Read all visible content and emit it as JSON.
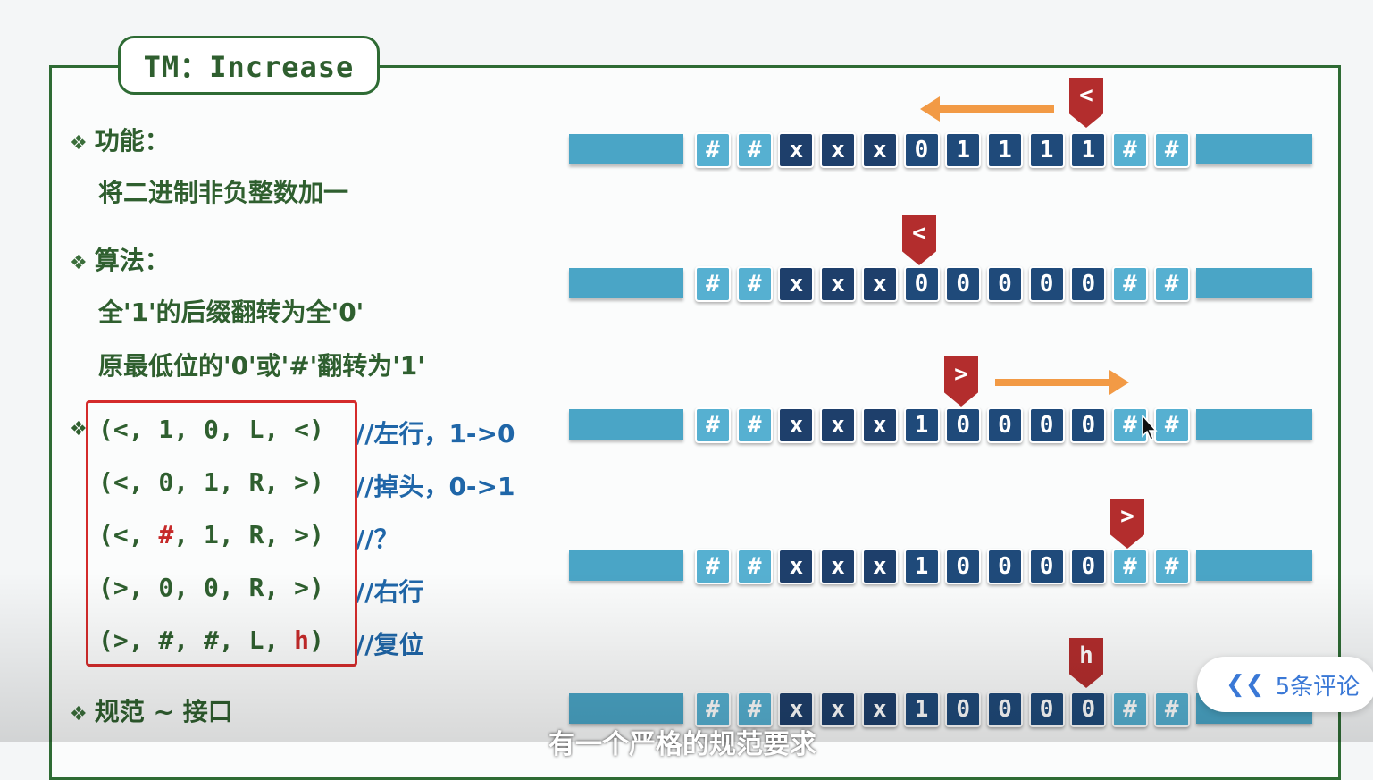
{
  "title": "TM：Increase",
  "sections": {
    "function_title": "功能：",
    "function_desc": "将二进制非负整数加一",
    "algorithm_title": "算法：",
    "algorithm_line1": "全'1'的后缀翻转为全'0'",
    "algorithm_line2": "原最低位的'0'或'#'翻转为'1'",
    "spec_title": "规范 ~ 接口"
  },
  "rules": [
    {
      "pre": "(<, 1, 0, L, <)",
      "comment": "//左行，1->0"
    },
    {
      "pre": "(<, 0, 1, R, >)",
      "comment": "//掉头，0->1"
    },
    {
      "pre_a": "(<, ",
      "pre_red": "#",
      "pre_b": ", 1, R, >)",
      "comment": "//？"
    },
    {
      "pre": "(>, 0, 0, R, >)",
      "comment": "//右行"
    },
    {
      "pre_a": "(>, #, #, L, ",
      "pre_red": "h",
      "pre_b": ")",
      "comment": "//复位"
    }
  ],
  "tapes": [
    {
      "cells": [
        "#",
        "#",
        "x",
        "x",
        "x",
        "0",
        "1",
        "1",
        "1",
        "1",
        "#",
        "#"
      ],
      "head": "<"
    },
    {
      "cells": [
        "#",
        "#",
        "x",
        "x",
        "x",
        "0",
        "0",
        "0",
        "0",
        "0",
        "#",
        "#"
      ],
      "head": "<"
    },
    {
      "cells": [
        "#",
        "#",
        "x",
        "x",
        "x",
        "1",
        "0",
        "0",
        "0",
        "0",
        "#",
        "#"
      ],
      "head": ">"
    },
    {
      "cells": [
        "#",
        "#",
        "x",
        "x",
        "x",
        "1",
        "0",
        "0",
        "0",
        "0",
        "#",
        "#"
      ],
      "head": ">"
    },
    {
      "cells": [
        "#",
        "#",
        "x",
        "x",
        "x",
        "1",
        "0",
        "0",
        "0",
        "0",
        "#",
        "#"
      ],
      "head": "h"
    }
  ],
  "comments_button": {
    "label": "5条评论",
    "icon": "double-chevron-left-icon"
  },
  "subtitle": "有一个严格的规范要求",
  "colors": {
    "frame": "#2e6b34",
    "tape_end": "#4aa5c6",
    "cell_dark": "#1e3f6b",
    "head": "#b32d2d",
    "arrow": "#f29a45",
    "rule_box": "#d42b2b",
    "comment": "#1f66a8"
  }
}
